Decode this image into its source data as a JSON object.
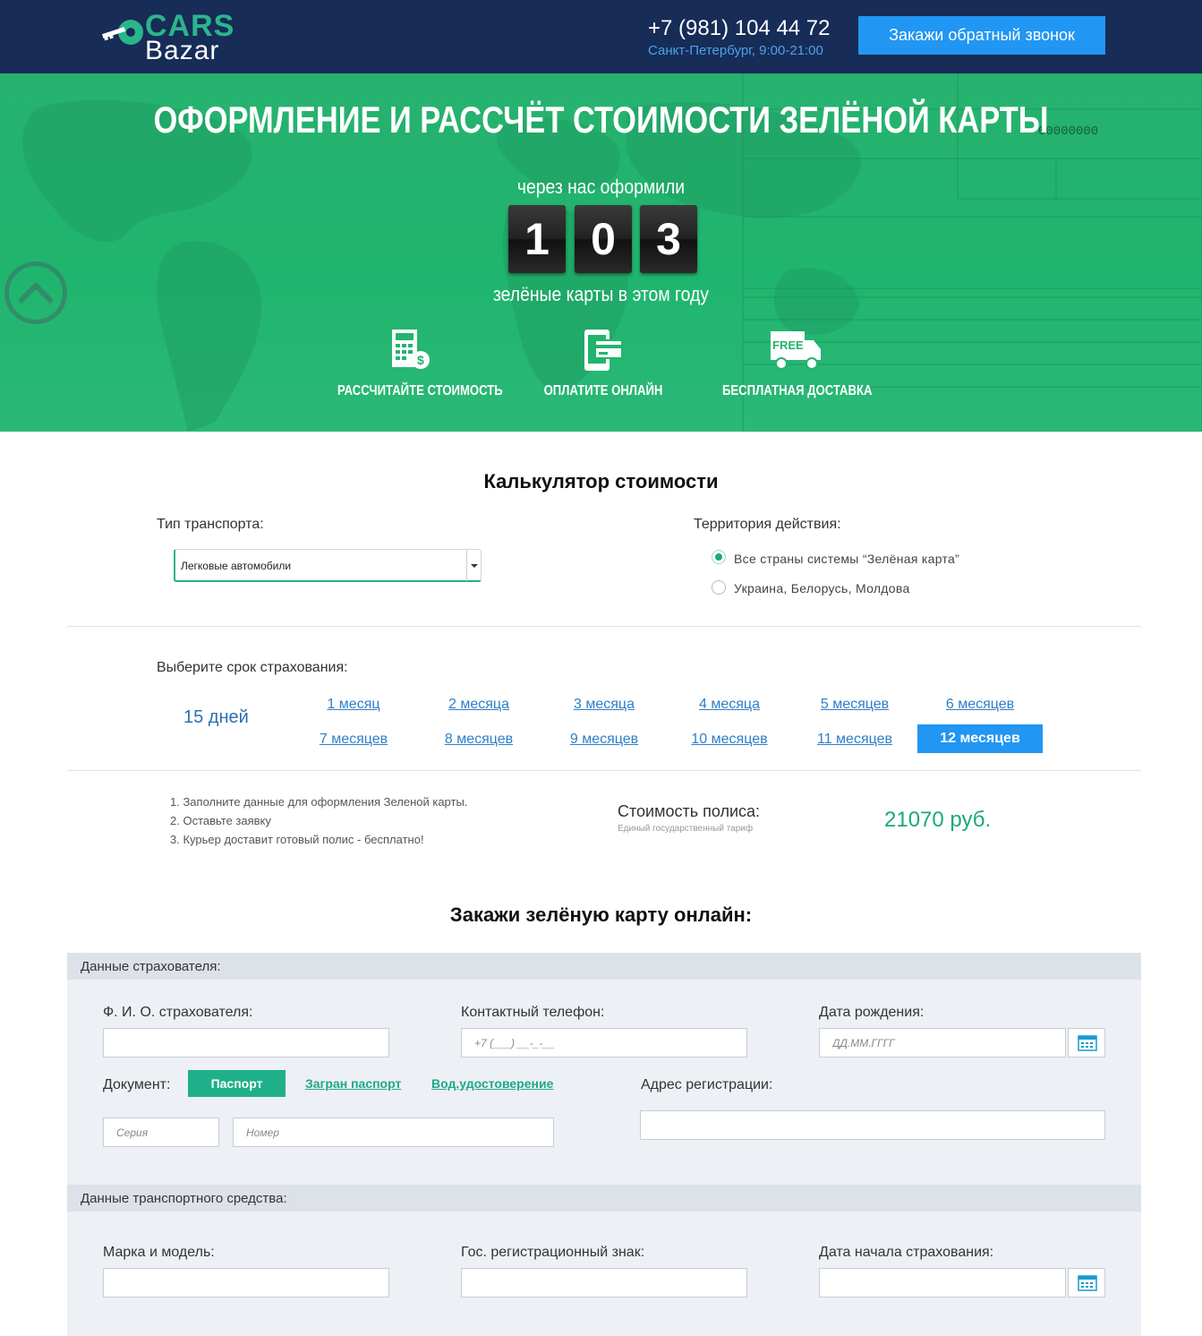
{
  "header": {
    "logo_top": "CARS",
    "logo_bottom": "Bazar",
    "phone": "+7 (981) 104 44 72",
    "hours": "Санкт-Петербург, 9:00-21:00",
    "callback_label": "Закажи обратный звонок"
  },
  "hero": {
    "title": "ОФОРМЛЕНИЕ И РАССЧЁТ СТОИМОСТИ ЗЕЛЁНОЙ КАРТЫ",
    "counter_label": "через нас оформили",
    "digits": [
      "1",
      "0",
      "3"
    ],
    "counter_sub": "зелёные карты в этом году",
    "doc_number": "00000000",
    "features": [
      {
        "label": "РАССЧИТАЙТЕ СТОИМОСТЬ",
        "icon": "calculator-icon"
      },
      {
        "label": "ОПЛАТИТЕ ОНЛАЙН",
        "icon": "card-payment-icon"
      },
      {
        "label": "БЕСПЛАТНАЯ ДОСТАВКА",
        "icon": "free-delivery-truck-icon"
      }
    ],
    "truck_badge": "FREE"
  },
  "calculator": {
    "title": "Калькулятор стоимости",
    "vehicle_label": "Тип транспорта:",
    "vehicle_value": "Легковые автомобили",
    "territory_label": "Территория действия:",
    "territory_options": [
      {
        "label": "Все страны системы “Зелёная карта”",
        "checked": true
      },
      {
        "label": "Украина, Белорусь, Молдова",
        "checked": false
      }
    ],
    "term_label": "Выберите срок страхования:",
    "term_first": "15 дней",
    "terms": [
      "1 месяц",
      "2 месяца",
      "3 месяца",
      "4 месяца",
      "5 месяцев",
      "6 месяцев",
      "7 месяцев",
      "8 месяцев",
      "9 месяцев",
      "10 месяцев",
      "11 месяцев",
      "12 месяцев"
    ],
    "active_term": "12 месяцев",
    "steps": [
      "1. Заполните данные для оформления Зеленой карты.",
      "2. Оставьте заявку",
      "3. Курьер доставит готовый полис - бесплатно!"
    ],
    "cost_label": "Стоимость полиса:",
    "cost_sub": "Единый государственный тариф",
    "cost_value": "21070 руб."
  },
  "order": {
    "title": "Закажи зелёную карту онлайн:",
    "insurer_head": "Данные страхователя:",
    "fio_label": "Ф. И. О. страхователя:",
    "phone_label": "Контактный телефон:",
    "phone_placeholder": "+7 (___) __-_-__",
    "birth_label": "Дата рождения:",
    "birth_placeholder": "ДД.ММ.ГГГГ",
    "document_label": "Документ:",
    "doc_passport": "Паспорт",
    "doc_foreign": "Загран паспорт",
    "doc_license": "Вод.удостоверение",
    "series_placeholder": "Серия",
    "number_placeholder": "Номер",
    "address_label": "Адрес регистрации:",
    "vehicle_head": "Данные транспортного средства:",
    "make_label": "Марка и модель:",
    "plate_label": "Гос. регистрационный знак:",
    "start_label": "Дата начала страхования:"
  },
  "colors": {
    "header_bg": "#172c57",
    "hero_green": "#22b46e",
    "accent_blue": "#2196f3",
    "accent_green": "#1fb08a"
  }
}
